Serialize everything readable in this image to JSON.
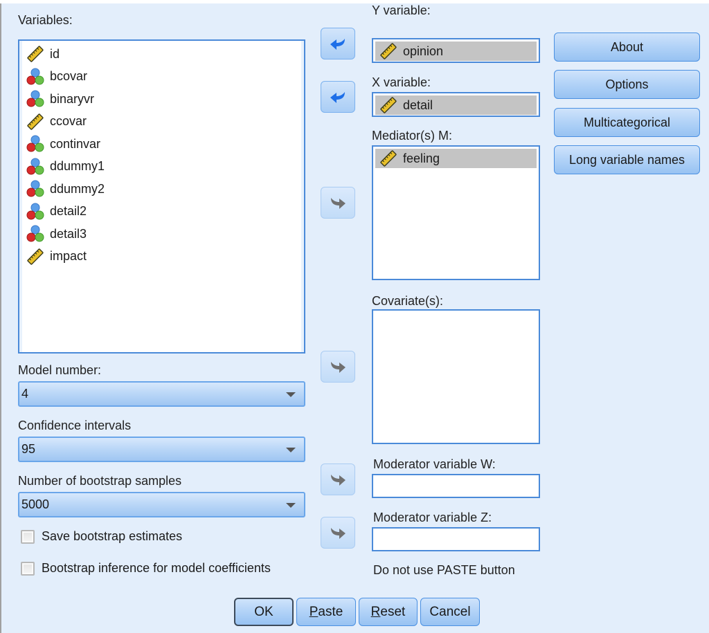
{
  "variables_panel": {
    "label": "Variables:",
    "items": [
      {
        "name": "id",
        "type": "scale",
        "icon": "ruler-icon"
      },
      {
        "name": "bcovar",
        "type": "nominal",
        "icon": "balls-icon"
      },
      {
        "name": "binaryvr",
        "type": "nominal",
        "icon": "balls-icon"
      },
      {
        "name": "ccovar",
        "type": "scale",
        "icon": "ruler-icon"
      },
      {
        "name": "continvar",
        "type": "nominal",
        "icon": "balls-icon"
      },
      {
        "name": "ddummy1",
        "type": "nominal",
        "icon": "balls-icon"
      },
      {
        "name": "ddummy2",
        "type": "nominal",
        "icon": "balls-icon"
      },
      {
        "name": "detail2",
        "type": "nominal",
        "icon": "balls-icon"
      },
      {
        "name": "detail3",
        "type": "nominal",
        "icon": "balls-icon"
      },
      {
        "name": "impact",
        "type": "scale",
        "icon": "ruler-icon"
      }
    ]
  },
  "model_number": {
    "label": "Model number:",
    "value": "4"
  },
  "confidence_intervals": {
    "label": "Confidence intervals",
    "value": "95"
  },
  "bootstrap_samples": {
    "label": "Number of bootstrap samples",
    "value": "5000"
  },
  "checkboxes": {
    "save_bootstrap": {
      "label": "Save bootstrap estimates",
      "checked": false
    },
    "bootstrap_inference": {
      "label": "Bootstrap inference for model coefficients",
      "checked": false
    }
  },
  "y_variable": {
    "label": "Y variable:",
    "value": "opinion",
    "icon": "ruler-icon"
  },
  "x_variable": {
    "label": "X variable:",
    "value": "detail",
    "icon": "ruler-icon"
  },
  "mediators": {
    "label": "Mediator(s) M:",
    "items": [
      {
        "name": "feeling",
        "icon": "ruler-icon"
      }
    ]
  },
  "covariates": {
    "label": "Covariate(s):",
    "items": []
  },
  "moderator_w": {
    "label": "Moderator variable W:",
    "value": ""
  },
  "moderator_z": {
    "label": "Moderator variable Z:",
    "value": ""
  },
  "note": "Do not use PASTE button",
  "side_buttons": {
    "about": "About",
    "options": "Options",
    "multicategorical": "Multicategorical",
    "long_names": "Long variable names"
  },
  "bottom_buttons": {
    "ok": "OK",
    "paste_mnemonic": "P",
    "paste_rest": "aste",
    "reset_mnemonic": "R",
    "reset_rest": "eset",
    "cancel": "Cancel"
  },
  "colors": {
    "background": "#e3eefb",
    "accent": "#4a8ad9",
    "arrow_active": "#1e6fe8",
    "arrow_disabled": "#707070"
  }
}
